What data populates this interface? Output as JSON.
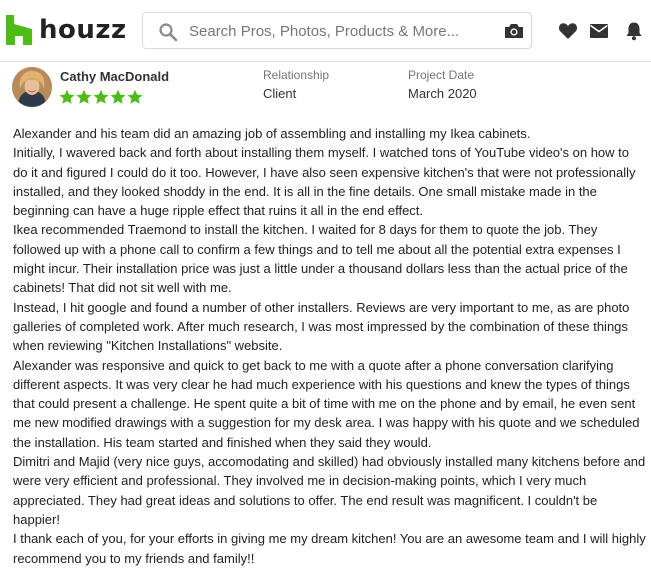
{
  "brand": {
    "name": "houzz",
    "accent": "#4dbc15"
  },
  "search": {
    "placeholder": "Search Pros, Photos, Products & More..."
  },
  "header_icons": [
    "heart-icon",
    "mail-icon",
    "bell-icon"
  ],
  "review": {
    "reviewer": "Cathy MacDonald",
    "rating": 5,
    "relationship_label": "Relationship",
    "relationship_value": "Client",
    "project_date_label": "Project Date",
    "project_date_value": "March 2020",
    "paragraphs": [
      "Alexander and his team did an amazing job of assembling and installing my Ikea cabinets.",
      "Initially, I wavered back and forth about installing them myself. I watched tons of YouTube video's on how to do it and figured I could do it too. However, I have also seen expensive kitchen's that were not professionally installed, and they looked shoddy in the end. It is all in the fine details. One small mistake made in the beginning can have a huge ripple effect that ruins it all in the end effect.",
      "Ikea recommended Traemond to install the kitchen. I waited for 8 days for them to quote the job. They followed up with a phone call to confirm a few things and to tell me about all the potential extra expenses I might incur. Their installation price was just a little under a thousand dollars less than the actual price of the cabinets! That did not sit well with me.",
      "Instead, I hit google and found a number of other installers. Reviews are very important to me, as are photo galleries of completed work. After much research, I was most impressed by the combination of these things when reviewing \"Kitchen Installations\" website.",
      "Alexander was responsive and quick to get back to me with a quote after a phone conversation clarifying different aspects. It was very clear he had much experience with his questions and knew the types of things that could present a challenge. He spent quite a bit of time with me on the phone and by email, he even sent me new modified drawings with a suggestion for my desk area. I was happy with his quote and we scheduled the installation. His team started and finished when they said they would.",
      "Dimitri and Majid (very nice guys, accomodating and skilled) had obviously installed many kitchens before and were very efficient and professional. They involved me in decision-making points, which I very much appreciated. They had great ideas and solutions to offer. The end result was magnificent. I couldn't be happier!",
      "I thank each of you, for your efforts in giving me my dream kitchen! You are an awesome team and I will highly recommend you to my friends and family!!"
    ]
  },
  "colors": {
    "star": "#4dbc15",
    "text": "#222222",
    "muted": "#757575"
  }
}
